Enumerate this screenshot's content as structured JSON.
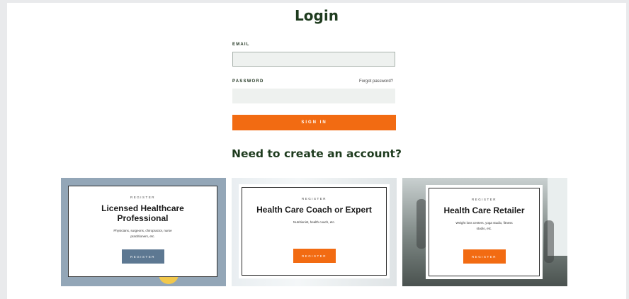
{
  "login": {
    "title": "Login",
    "email_label": "EMAIL",
    "email_value": "",
    "password_label": "PASSWORD",
    "password_value": "",
    "forgot_link": "Forgot password?",
    "signin_button": "SIGN IN"
  },
  "register": {
    "heading": "Need to create an account?",
    "cards": [
      {
        "eyebrow": "REGISTER",
        "title": "Licensed Healthcare Professional",
        "desc": "Physicians, surgeons, chiropractor, nurse practitioners, etc.",
        "button": "REGISTER",
        "button_color": "#5d7892"
      },
      {
        "eyebrow": "REGISTER",
        "title": "Health Care Coach or Expert",
        "desc": "Nutritionist, health coach, etc.",
        "button": "REGISTER",
        "button_color": "#f26b12"
      },
      {
        "eyebrow": "REGISTER",
        "title": "Health Care Retailer",
        "desc": "Weight loss centers, yoga studio, fitness studio, etc.",
        "button": "REGISTER",
        "button_color": "#f26b12"
      }
    ]
  },
  "colors": {
    "accent": "#f26b12",
    "heading": "#1e3b1e",
    "professional_bg": "#93a6b7"
  }
}
